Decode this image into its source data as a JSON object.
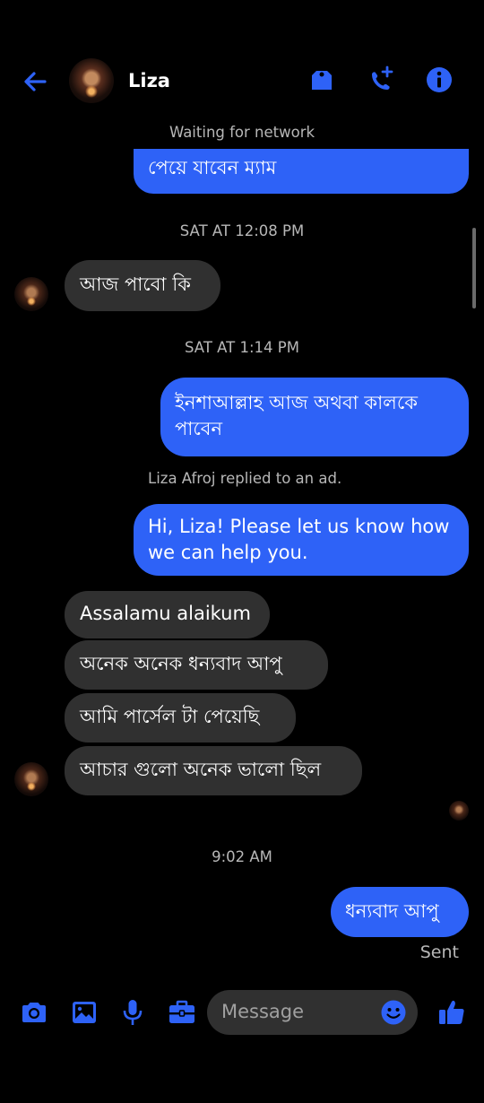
{
  "header": {
    "contact_name": "Liza"
  },
  "status": {
    "network": "Waiting for network"
  },
  "messages": {
    "m1": "পেয়ে যাবেন ম্যাম",
    "t1": "SAT AT 12:08 PM",
    "m2": "আজ পাবো কি",
    "t2": "SAT AT 1:14 PM",
    "m3_line1": "ইনশাআল্লাহ আজ অথবা কালকে",
    "m3_line2": "পাবেন",
    "ad_note": "Liza Afroj replied to an ad.",
    "m4_line1": "Hi, Liza! Please let us know how",
    "m4_line2": "we can help you.",
    "m5": "Assalamu alaikum",
    "m6": "অনেক অনেক ধন্যবাদ আপু",
    "m7": "আমি পার্সেল টা পেয়েছি",
    "m8": "আচার গুলো অনেক ভালো ছিল",
    "t3": "9:02 AM",
    "m9": "ধন্যবাদ আপু",
    "sent_label": "Sent"
  },
  "composer": {
    "placeholder": "Message"
  },
  "colors": {
    "accent": "#2e62f7",
    "incoming_bubble": "#303030",
    "background": "#000000"
  },
  "icons": [
    "back-arrow-icon",
    "tag-icon",
    "call-add-icon",
    "info-icon",
    "camera-icon",
    "image-icon",
    "microphone-icon",
    "briefcase-icon",
    "emoji-icon",
    "thumbs-up-icon"
  ]
}
